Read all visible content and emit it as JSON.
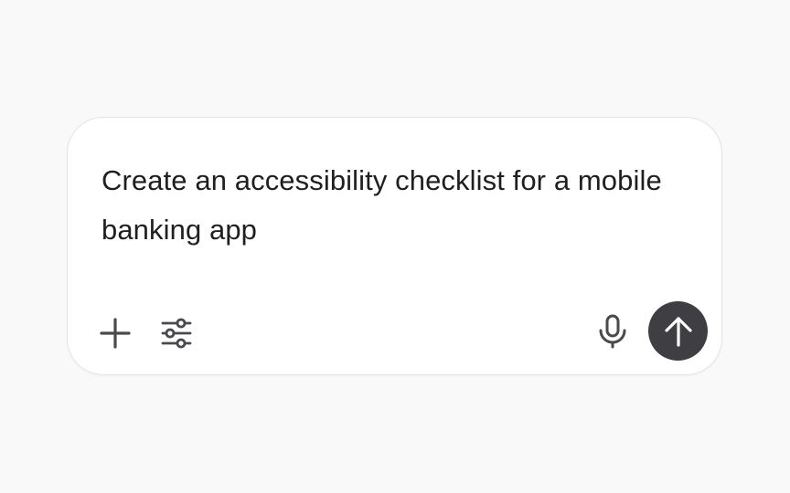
{
  "composer": {
    "prompt_text": "Create an accessibility checklist for a mobile banking app"
  },
  "icons": {
    "add": "plus-icon",
    "tools": "sliders-icon",
    "voice": "microphone-icon",
    "send": "arrow-up-icon"
  },
  "colors": {
    "page_background": "#f9f9f9",
    "composer_background": "#ffffff",
    "text": "#1f1f1f",
    "icon": "#4a4a4e",
    "send_button": "#3f3f43"
  }
}
